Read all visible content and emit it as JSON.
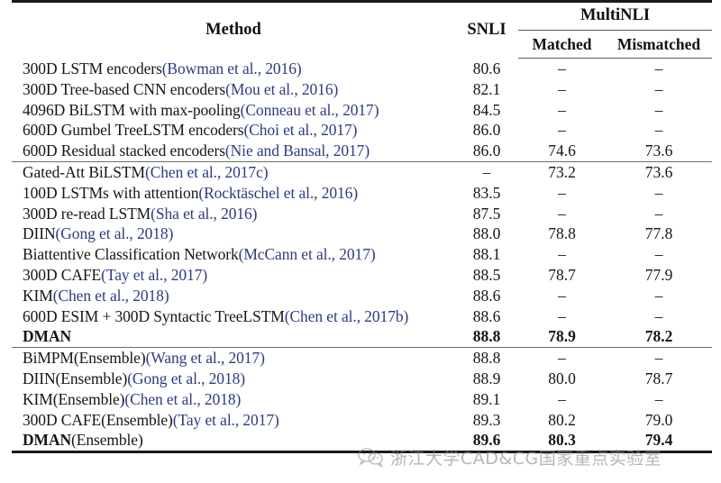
{
  "table": {
    "columns": {
      "method": "Method",
      "snli": "SNLI",
      "multinli": "MultiNLI",
      "matched": "Matched",
      "mismatched": "Mismatched"
    },
    "groups": [
      {
        "rows": [
          {
            "method_plain": "300D LSTM encoders",
            "method_cite": "(Bowman et al., 2016)",
            "snli": "80.6",
            "matched": "–",
            "mismatched": "–",
            "bold": false
          },
          {
            "method_plain": "300D Tree-based CNN encoders",
            "method_cite": "(Mou et al., 2016)",
            "snli": "82.1",
            "matched": "–",
            "mismatched": "–",
            "bold": false
          },
          {
            "method_plain": "4096D BiLSTM with max-pooling",
            "method_cite": "(Conneau et al., 2017)",
            "snli": "84.5",
            "matched": "–",
            "mismatched": "–",
            "bold": false
          },
          {
            "method_plain": "600D Gumbel TreeLSTM encoders",
            "method_cite": "(Choi et al., 2017)",
            "snli": "86.0",
            "matched": "–",
            "mismatched": "–",
            "bold": false
          },
          {
            "method_plain": "600D Residual stacked encoders",
            "method_cite": "(Nie and Bansal, 2017)",
            "snli": "86.0",
            "matched": "74.6",
            "mismatched": "73.6",
            "bold": false
          }
        ]
      },
      {
        "rows": [
          {
            "method_plain": "Gated-Att BiLSTM",
            "method_cite": "(Chen et al., 2017c)",
            "snli": "–",
            "matched": "73.2",
            "mismatched": "73.6",
            "bold": false
          },
          {
            "method_plain": "100D LSTMs with attention",
            "method_cite": "(Rocktäschel et al., 2016)",
            "snli": "83.5",
            "matched": "–",
            "mismatched": "–",
            "bold": false
          },
          {
            "method_plain": "300D re-read LSTM",
            "method_cite": "(Sha et al., 2016)",
            "snli": "87.5",
            "matched": "–",
            "mismatched": "–",
            "bold": false
          },
          {
            "method_plain": "DIIN",
            "method_cite": "(Gong et al., 2018)",
            "snli": "88.0",
            "matched": "78.8",
            "mismatched": "77.8",
            "bold": false
          },
          {
            "method_plain": "Biattentive Classification Network",
            "method_cite": "(McCann et al., 2017)",
            "snli": "88.1",
            "matched": "–",
            "mismatched": "–",
            "bold": false
          },
          {
            "method_plain": "300D CAFE",
            "method_cite": "(Tay et al., 2017)",
            "snli": "88.5",
            "matched": "78.7",
            "mismatched": "77.9",
            "bold": false
          },
          {
            "method_plain": "KIM",
            "method_cite": "(Chen et al., 2018)",
            "snli": "88.6",
            "matched": "–",
            "mismatched": "–",
            "bold": false
          },
          {
            "method_plain": "600D ESIM + 300D Syntactic TreeLSTM",
            "method_cite": "(Chen et al., 2017b)",
            "snli": "88.6",
            "matched": "–",
            "mismatched": "–",
            "bold": false
          },
          {
            "method_plain": "DMAN",
            "method_cite": "",
            "snli": "88.8",
            "matched": "78.9",
            "mismatched": "78.2",
            "bold": true
          }
        ]
      },
      {
        "rows": [
          {
            "method_plain": "BiMPM(Ensemble)",
            "method_cite": "(Wang et al., 2017)",
            "snli": "88.8",
            "matched": "–",
            "mismatched": "–",
            "bold": false
          },
          {
            "method_plain": "DIIN(Ensemble)",
            "method_cite": "(Gong et al., 2018)",
            "snli": "88.9",
            "matched": "80.0",
            "mismatched": "78.7",
            "bold": false
          },
          {
            "method_plain": "KIM(Ensemble)",
            "method_cite": "(Chen et al., 2018)",
            "snli": "89.1",
            "matched": "–",
            "mismatched": "–",
            "bold": false
          },
          {
            "method_plain": "300D CAFE(Ensemble)",
            "method_cite": "(Tay et al., 2017)",
            "snli": "89.3",
            "matched": "80.2",
            "mismatched": "79.0",
            "bold": false
          },
          {
            "method_plain_bold": "DMAN",
            "method_plain": "(Ensemble)",
            "method_cite": "",
            "snli": "89.6",
            "matched": "80.3",
            "mismatched": "79.4",
            "bold": false,
            "lead_bold": true
          }
        ]
      }
    ]
  },
  "watermark": {
    "text": "浙江大学CAD&CG国家重点实验室",
    "logo": "wechat-icon",
    "color": "#8a8a8a"
  },
  "colors": {
    "citation_blue": "#2e3b80",
    "rule_dark": "#1a1a1a",
    "rule_light": "#6e6e6e",
    "text": "#161616",
    "background": "#ffffff"
  }
}
